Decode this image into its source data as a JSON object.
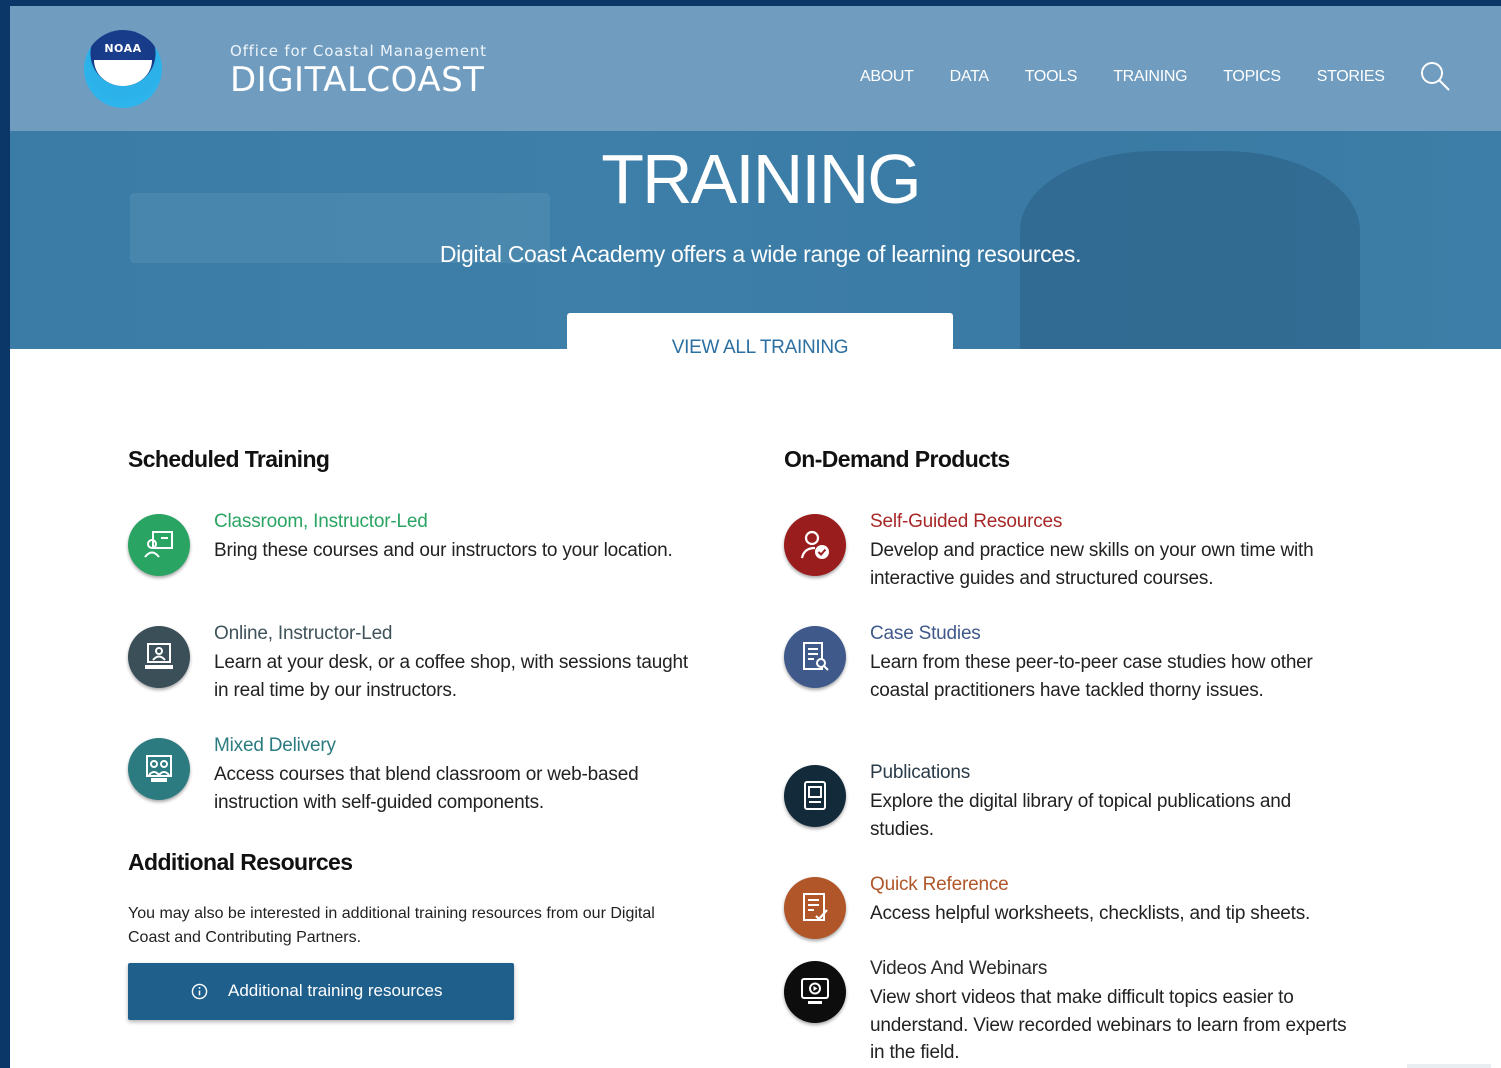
{
  "header": {
    "org": "Office for Coastal Management",
    "brand": "DIGITALCOAST",
    "logo_text": "NOAA",
    "nav": [
      "ABOUT",
      "DATA",
      "TOOLS",
      "TRAINING",
      "TOPICS",
      "STORIES"
    ]
  },
  "hero": {
    "title": "TRAINING",
    "subtitle": "Digital Coast Academy offers a wide range of learning resources.",
    "cta": "VIEW ALL TRAINING"
  },
  "scheduled": {
    "heading": "Scheduled Training",
    "items": [
      {
        "title": "Classroom, Instructor-Led",
        "desc": "Bring these courses and our instructors to your location.",
        "icon": "classroom-icon",
        "color": "#2aa463",
        "title_color": "#2aa463"
      },
      {
        "title": "Online, Instructor-Led",
        "desc": "Learn at your desk, or a coffee shop, with sessions taught in real time by our instructors.",
        "icon": "online-instructor-icon",
        "color": "#3a4f57",
        "title_color": "#3f535b"
      },
      {
        "title": "Mixed Delivery",
        "desc": "Access courses that blend classroom or web-based instruction with self-guided components.",
        "icon": "mixed-delivery-icon",
        "color": "#2c7b80",
        "title_color": "#2c7b80"
      }
    ]
  },
  "additional": {
    "heading": "Additional Resources",
    "text": "You may also be interested in additional training resources from our Digital Coast and Contributing Partners.",
    "button": "Additional training resources"
  },
  "ondemand": {
    "heading": "On-Demand Products",
    "items": [
      {
        "title": "Self-Guided Resources",
        "desc": "Develop and practice new skills on your own time with interactive guides and structured courses.",
        "icon": "self-guided-icon",
        "color": "#9a1d1d",
        "title_color": "#a82828"
      },
      {
        "title": "Case Studies",
        "desc": "Learn from these peer-to-peer case studies how other coastal practitioners have tackled thorny issues.",
        "icon": "case-study-icon",
        "color": "#3f5a8a",
        "title_color": "#3f5a8a"
      },
      {
        "title": "Publications",
        "desc": "Explore the digital library of topical publications and studies.",
        "icon": "publication-icon",
        "color": "#132a3b",
        "title_color": "#2b3b48"
      },
      {
        "title": "Quick Reference",
        "desc": "Access helpful worksheets, checklists, and tip sheets.",
        "icon": "checklist-icon",
        "color": "#b05629",
        "title_color": "#b05629"
      },
      {
        "title": "Videos And Webinars",
        "desc": "View short videos that make difficult topics easier to understand. View recorded webinars to learn from experts in the field.",
        "icon": "video-icon",
        "color": "#0d0d0d",
        "title_color": "#2b2b2b"
      }
    ]
  }
}
